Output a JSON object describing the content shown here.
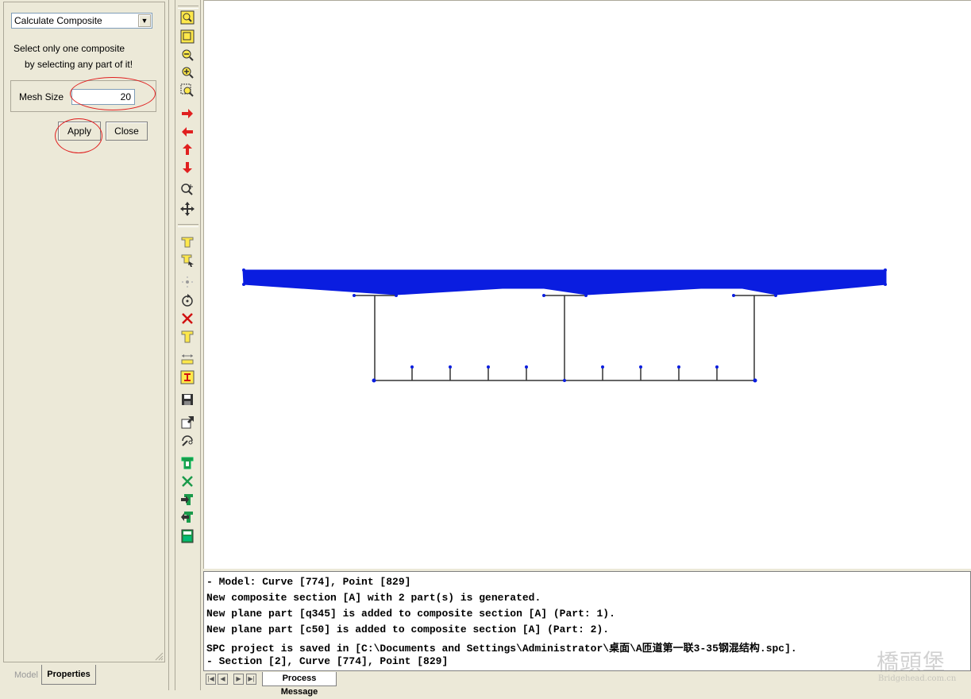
{
  "properties": {
    "command_select": "Calculate Composite",
    "hint_line1": "Select only one composite",
    "hint_line2": "by selecting any part of it!",
    "mesh_size_label": "Mesh Size",
    "mesh_size_value": "20",
    "apply_label": "Apply",
    "close_label": "Close",
    "tabs": {
      "model": "Model",
      "properties": "Properties"
    }
  },
  "toolbar": {
    "icons": [
      "zoom-fit-icon",
      "zoom-window-icon",
      "zoom-out-icon",
      "zoom-in-icon",
      "zoom-region-icon",
      "pan-right-icon",
      "pan-left-icon",
      "pan-up-icon",
      "pan-down-icon",
      "dynamic-zoom-icon",
      "move-icon",
      "section-icon",
      "section-select-icon",
      "point-icon",
      "rotate-icon",
      "delete-icon",
      "part-icon",
      "dimension-icon",
      "ibeam-icon",
      "save-icon",
      "export-icon",
      "edit-icon",
      "composite-icon",
      "delete-composite-icon",
      "add-part-icon",
      "import-part-icon",
      "calculator-icon"
    ]
  },
  "messages": {
    "lines": [
      "- Model: Curve [774], Point [829]",
      "New composite section [A] with 2 part(s) is generated.",
      "New plane part [q345] is added to composite section [A] (Part: 1).",
      "New plane part [c50] is added to composite section [A] (Part: 2).",
      "SPC project is saved in [C:\\Documents and Settings\\Administrator\\桌面\\A匝道第一联3-35钢混结构.spc].",
      "- Section [2], Curve [774], Point [829]"
    ],
    "tab": "Process Message"
  },
  "colors": {
    "deck": "#0a1de0",
    "highlight_ring": "#e02020",
    "chrome": "#ece9d8"
  },
  "watermark": {
    "name": "橋頭堡",
    "site": "Bridgehead.com.cn"
  }
}
